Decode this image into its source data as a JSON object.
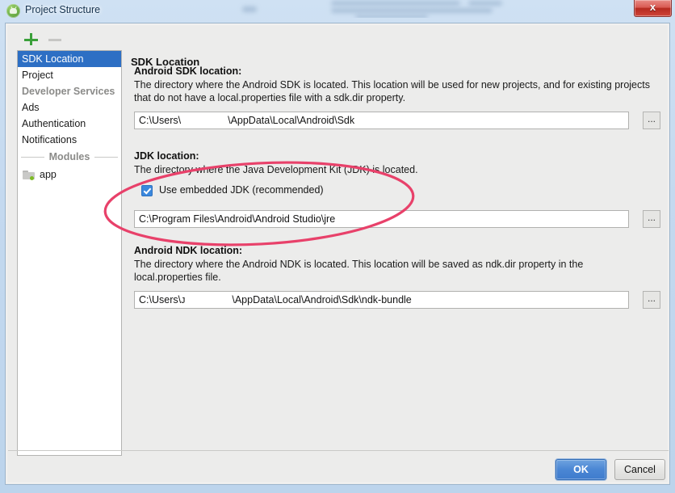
{
  "window": {
    "title": "Project Structure",
    "icon": "android-studio-icon",
    "close_label": "x"
  },
  "toolbar": {
    "add_label": "+",
    "remove_label": "–"
  },
  "sidebar": {
    "items": [
      {
        "label": "SDK Location",
        "type": "item",
        "selected": true
      },
      {
        "label": "Project",
        "type": "item",
        "selected": false
      },
      {
        "label": "Developer Services",
        "type": "group",
        "selected": false
      },
      {
        "label": "Ads",
        "type": "item",
        "selected": false
      },
      {
        "label": "Authentication",
        "type": "item",
        "selected": false
      },
      {
        "label": "Notifications",
        "type": "item",
        "selected": false
      }
    ],
    "separator_label": "Modules",
    "modules": [
      {
        "label": "app",
        "icon": "folder-icon"
      }
    ]
  },
  "content": {
    "header": "SDK Location",
    "sections": [
      {
        "title": "Android SDK location:",
        "description": "The directory where the Android SDK is located. This location will be used for new projects, and for existing projects that do not have a local.properties file with a sdk.dir property.",
        "value_prefix": "C:\\Users\\",
        "value_suffix": "\\AppData\\Local\\Android\\Sdk",
        "browse_label": "..."
      },
      {
        "title": "JDK location:",
        "description": "The directory where the Java Development Kit (JDK) is located.",
        "checkbox_label": "Use embedded JDK (recommended)",
        "checkbox_checked": true,
        "value": "C:\\Program Files\\Android\\Android Studio\\jre",
        "browse_label": "..."
      },
      {
        "title": "Android NDK location:",
        "description": "The directory where the Android NDK is located. This location will be saved as ndk.dir property in the local.properties file.",
        "value_prefix": "C:\\Users\\ᴊ",
        "value_suffix": "\\AppData\\Local\\Android\\Sdk\\ndk-bundle",
        "browse_label": "..."
      }
    ]
  },
  "footer": {
    "ok_label": "OK",
    "cancel_label": "Cancel"
  },
  "annotation": {
    "shape": "ellipse-highlight",
    "color": "#e8416a"
  },
  "colors": {
    "selection_blue": "#2d6fc4",
    "checkbox_blue": "#3b88dd",
    "accent_green": "#3aa03a",
    "annotation_pink": "#e8416a",
    "dialog_bg": "#ececeb"
  }
}
